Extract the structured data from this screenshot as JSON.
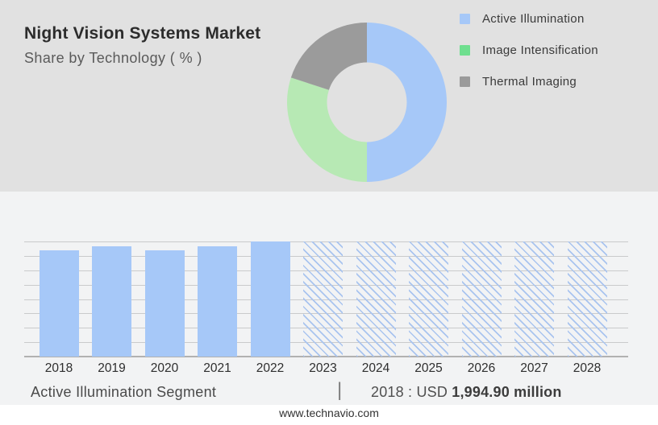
{
  "header": {
    "title": "Night Vision Systems Market",
    "subtitle": "Share by Technology ( % )"
  },
  "legend": {
    "items": [
      {
        "label": "Active Illumination",
        "swatch_color": "#a6c8f8"
      },
      {
        "label": "Image Intensification",
        "swatch_color": "#6fdf8f"
      },
      {
        "label": "Thermal Imaging",
        "swatch_color": "#9a9a9a"
      }
    ]
  },
  "footer": {
    "segment_label": "Active Illumination Segment",
    "separator": "|",
    "value_prefix": "2018 : USD ",
    "value_bold": "1,994.90 million",
    "website": "www.technavio.com"
  },
  "chart_data": [
    {
      "type": "pie",
      "subtype": "donut",
      "title": "Share by Technology ( % )",
      "labels": [
        "Active Illumination",
        "Image Intensification",
        "Thermal Imaging"
      ],
      "values": [
        50,
        30,
        20
      ],
      "colors": [
        "#a6c8f8",
        "#b7e9b4",
        "#9b9b9b"
      ],
      "start_angle_deg": 0,
      "clockwise": true,
      "inner_radius_ratio": 0.5,
      "hole_color": "#e4e4e4",
      "legend_position": "right",
      "data_labels": false
    },
    {
      "type": "bar",
      "categories": [
        "2018",
        "2019",
        "2020",
        "2021",
        "2022",
        "2023",
        "2024",
        "2025",
        "2026",
        "2027",
        "2028"
      ],
      "values_relative_pct": [
        92,
        96,
        92,
        96,
        100,
        100,
        100,
        100,
        100,
        100,
        100
      ],
      "bar_styles": [
        "solid",
        "solid",
        "solid",
        "solid",
        "solid",
        "hatched",
        "hatched",
        "hatched",
        "hatched",
        "hatched",
        "hatched"
      ],
      "bar_color": "#a6c8f8",
      "hatch_line_color": "#a9c4ef",
      "gridline_count": 9,
      "grid_on": true,
      "y_axis_labels_visible": false,
      "xlabel": "",
      "ylabel": "",
      "annotation": "2018 : USD 1,994.90 million",
      "note": "2018-2022 historical (solid bars), 2023-2028 forecast (hatched bars); y-axis has no tick labels"
    }
  ]
}
